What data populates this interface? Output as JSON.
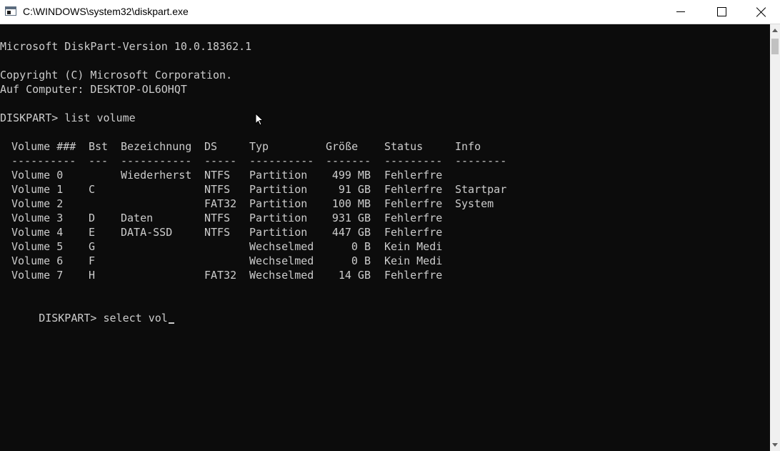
{
  "window": {
    "title": "C:\\WINDOWS\\system32\\diskpart.exe",
    "icon": "console-window-icon"
  },
  "console": {
    "version_line": "Microsoft DiskPart-Version 10.0.18362.1",
    "copyright_line": "Copyright (C) Microsoft Corporation.",
    "computer_line": "Auf Computer: DESKTOP-OL6OHQT",
    "prompt1": "DISKPART> list volume",
    "prompt2": "DISKPART> select vol",
    "headers": [
      "Volume ###",
      "Bst",
      "Bezeichnung",
      "DS",
      "Typ",
      "Größe",
      "Status",
      "Info"
    ],
    "separators": [
      "----------",
      "---",
      "-----------",
      "-----",
      "----------",
      "-------",
      "---------",
      "--------"
    ],
    "volumes": [
      {
        "num": "Volume 0",
        "bst": "",
        "label": "Wiederherst",
        "fs": "NTFS",
        "type": "Partition",
        "size": "499 MB",
        "status": "Fehlerfre",
        "info": ""
      },
      {
        "num": "Volume 1",
        "bst": "C",
        "label": "",
        "fs": "NTFS",
        "type": "Partition",
        "size": "91 GB",
        "status": "Fehlerfre",
        "info": "Startpar"
      },
      {
        "num": "Volume 2",
        "bst": "",
        "label": "",
        "fs": "FAT32",
        "type": "Partition",
        "size": "100 MB",
        "status": "Fehlerfre",
        "info": "System"
      },
      {
        "num": "Volume 3",
        "bst": "D",
        "label": "Daten",
        "fs": "NTFS",
        "type": "Partition",
        "size": "931 GB",
        "status": "Fehlerfre",
        "info": ""
      },
      {
        "num": "Volume 4",
        "bst": "E",
        "label": "DATA-SSD",
        "fs": "NTFS",
        "type": "Partition",
        "size": "447 GB",
        "status": "Fehlerfre",
        "info": ""
      },
      {
        "num": "Volume 5",
        "bst": "G",
        "label": "",
        "fs": "",
        "type": "Wechselmed",
        "size": "0 B",
        "status": "Kein Medi",
        "info": ""
      },
      {
        "num": "Volume 6",
        "bst": "F",
        "label": "",
        "fs": "",
        "type": "Wechselmed",
        "size": "0 B",
        "status": "Kein Medi",
        "info": ""
      },
      {
        "num": "Volume 7",
        "bst": "H",
        "label": "",
        "fs": "FAT32",
        "type": "Wechselmed",
        "size": "14 GB",
        "status": "Fehlerfre",
        "info": ""
      }
    ]
  },
  "colors": {
    "console_bg": "#0c0c0c",
    "console_fg": "#cccccc"
  }
}
